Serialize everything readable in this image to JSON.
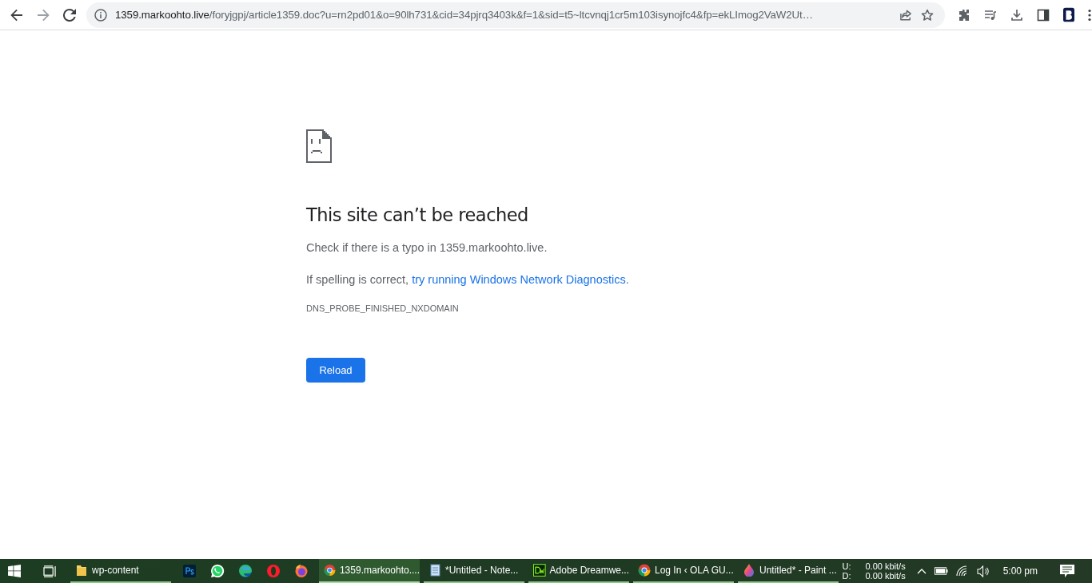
{
  "toolbar": {
    "back": {
      "disabled": false
    },
    "forward": {
      "disabled": true
    },
    "address": {
      "host": "1359.markoohto.live",
      "path": "/foryjgpj/article1359.doc?u=rn2pd01&o=90lh731&cid=34pjrq3403k&f=1&sid=t5~ltcvnqj1cr5m103isynojfc4&fp=ekLImog2VaW2Ut…"
    }
  },
  "error_page": {
    "title": "This site can’t be reached",
    "message": "Check if there is a typo in 1359.markoohto.live.",
    "suggestion": "If spelling is correct, ",
    "suggestion_link": "try running Windows Network Diagnostics",
    "suggestion_end": ".",
    "error_code": "DNS_PROBE_FINISHED_NXDOMAIN",
    "button": "Reload"
  },
  "taskbar": {
    "windows": [
      {
        "kind": "folder",
        "label": "wp-content",
        "selected": false
      },
      {
        "kind": "chrome",
        "label": "1359.markoohto....",
        "selected": true
      },
      {
        "kind": "notepad",
        "label": "*Untitled - Note...",
        "selected": false
      },
      {
        "kind": "dreamweaver",
        "label": "Adobe Dreamwe...",
        "selected": false
      },
      {
        "kind": "chrome",
        "label": "Log In ‹ OLA GU...",
        "selected": false
      },
      {
        "kind": "paint",
        "label": "Untitled* - Paint ...",
        "selected": false
      }
    ],
    "network": {
      "up_label": "U:",
      "down_label": "D:",
      "up_rate": "0.00 kbit/s",
      "down_rate": "0.00 kbit/s"
    },
    "time": "5:00 pm"
  }
}
